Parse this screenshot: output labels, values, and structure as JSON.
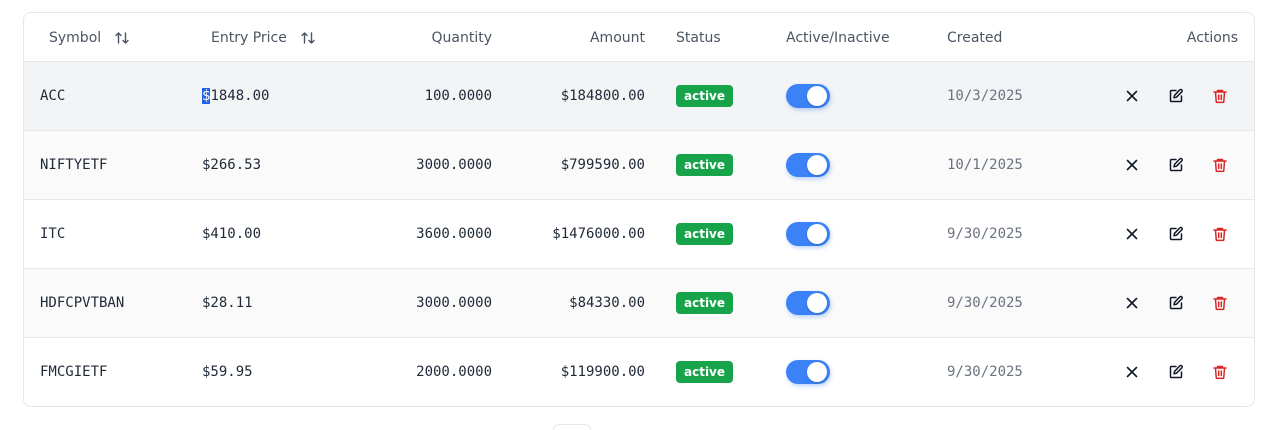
{
  "table": {
    "headers": {
      "symbol": "Symbol",
      "entry_price": "Entry Price",
      "quantity": "Quantity",
      "amount": "Amount",
      "status": "Status",
      "active_inactive": "Active/Inactive",
      "created": "Created",
      "actions": "Actions"
    },
    "rows": [
      {
        "symbol": "ACC",
        "entry_price_prefix": "$",
        "entry_price_rest": "1848.00",
        "entry_price": "$1848.00",
        "quantity": "100.0000",
        "amount": "$184800.00",
        "status": "active",
        "active": true,
        "created": "10/3/2025"
      },
      {
        "symbol": "NIFTYETF",
        "entry_price": "$266.53",
        "quantity": "3000.0000",
        "amount": "$799590.00",
        "status": "active",
        "active": true,
        "created": "10/1/2025"
      },
      {
        "symbol": "ITC",
        "entry_price": "$410.00",
        "quantity": "3600.0000",
        "amount": "$1476000.00",
        "status": "active",
        "active": true,
        "created": "9/30/2025"
      },
      {
        "symbol": "HDFCPVTBAN",
        "entry_price": "$28.11",
        "quantity": "3000.0000",
        "amount": "$84330.00",
        "status": "active",
        "active": true,
        "created": "9/30/2025"
      },
      {
        "symbol": "FMCGIETF",
        "entry_price": "$59.95",
        "quantity": "2000.0000",
        "amount": "$119900.00",
        "status": "active",
        "active": true,
        "created": "9/30/2025"
      }
    ]
  },
  "icons": {
    "sort": "sort-arrows-icon",
    "close": "close-icon",
    "edit": "edit-icon",
    "delete": "trash-icon"
  },
  "colors": {
    "status_active": "#16a34a",
    "toggle_on": "#3b82f6",
    "delete": "#dc2626",
    "selection": "#2563eb"
  }
}
